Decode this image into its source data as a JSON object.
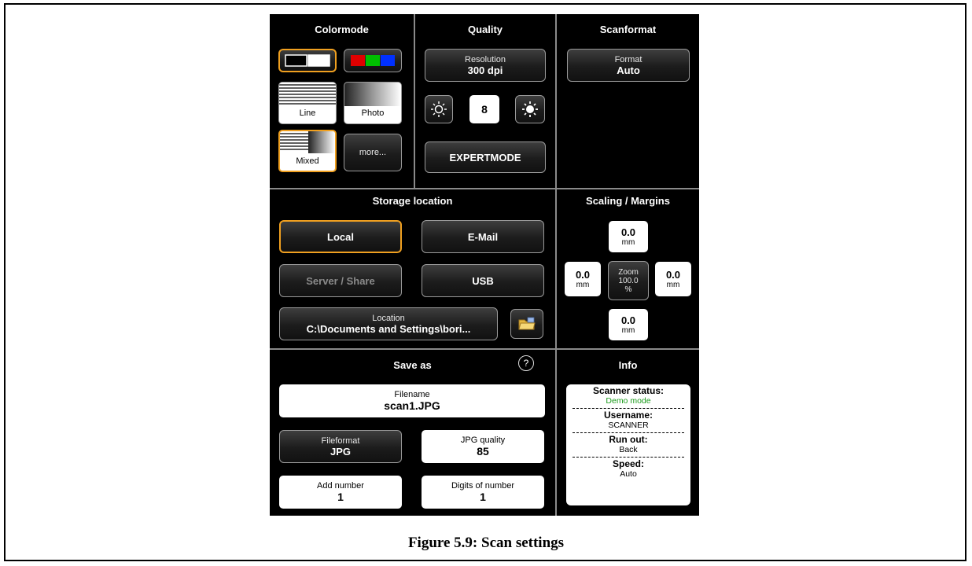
{
  "colormode": {
    "title": "Colormode",
    "line_label": "Line",
    "photo_label": "Photo",
    "mixed_label": "Mixed",
    "more_label": "more..."
  },
  "quality": {
    "title": "Quality",
    "resolution_label": "Resolution",
    "resolution_value": "300 dpi",
    "brightness_value": "8",
    "expert_label": "EXPERTMODE"
  },
  "scanformat": {
    "title": "Scanformat",
    "format_label": "Format",
    "format_value": "Auto"
  },
  "storage": {
    "title": "Storage location",
    "local": "Local",
    "email": "E-Mail",
    "server": "Server / Share",
    "usb": "USB",
    "location_label": "Location",
    "location_value": "C:\\Documents and Settings\\bori..."
  },
  "scaling": {
    "title": "Scaling / Margins",
    "top_value": "0.0",
    "left_value": "0.0",
    "right_value": "0.0",
    "bottom_value": "0.0",
    "unit": "mm",
    "zoom_label": "Zoom",
    "zoom_value": "100.0",
    "zoom_unit": "%"
  },
  "save_as": {
    "title": "Save as",
    "help": "?",
    "filename_label": "Filename",
    "filename_value": "scan1.JPG",
    "fileformat_label": "Fileformat",
    "fileformat_value": "JPG",
    "jpg_quality_label": "JPG quality",
    "jpg_quality_value": "85",
    "add_number_label": "Add number",
    "add_number_value": "1",
    "digits_label": "Digits of number",
    "digits_value": "1"
  },
  "info": {
    "title": "Info",
    "scanner_status_label": "Scanner status:",
    "scanner_status_value": "Demo mode",
    "username_label": "Username:",
    "username_value": "SCANNER",
    "runout_label": "Run out:",
    "runout_value": "Back",
    "speed_label": "Speed:",
    "speed_value": "Auto"
  },
  "colors": {
    "selected_border": "#f0a020",
    "status_green": "#1a9a1a"
  },
  "caption": "Figure 5.9: Scan settings"
}
